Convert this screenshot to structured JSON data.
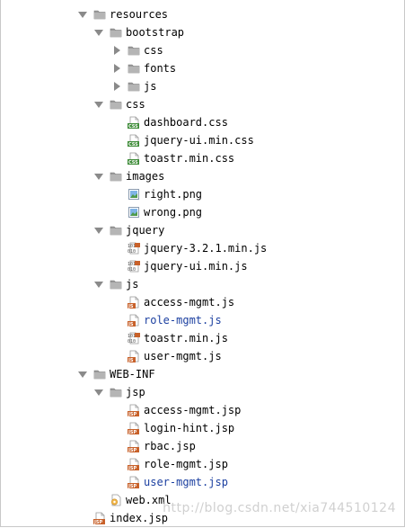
{
  "tree": [
    {
      "id": "resources",
      "label": "resources",
      "type": "folder",
      "state": "expanded",
      "depth": 0
    },
    {
      "id": "bootstrap",
      "label": "bootstrap",
      "type": "folder",
      "state": "expanded",
      "depth": 1
    },
    {
      "id": "bootstrap-css",
      "label": "css",
      "type": "folder",
      "state": "collapsed",
      "depth": 2
    },
    {
      "id": "bootstrap-fonts",
      "label": "fonts",
      "type": "folder",
      "state": "collapsed",
      "depth": 2
    },
    {
      "id": "bootstrap-js",
      "label": "js",
      "type": "folder",
      "state": "collapsed",
      "depth": 2
    },
    {
      "id": "css",
      "label": "css",
      "type": "folder",
      "state": "expanded",
      "depth": 1
    },
    {
      "id": "dashboard-css",
      "label": "dashboard.css",
      "type": "css",
      "depth": 2
    },
    {
      "id": "jquery-ui-min-css",
      "label": "jquery-ui.min.css",
      "type": "css",
      "depth": 2
    },
    {
      "id": "toastr-min-css",
      "label": "toastr.min.css",
      "type": "css",
      "depth": 2
    },
    {
      "id": "images",
      "label": "images",
      "type": "folder",
      "state": "expanded",
      "depth": 1
    },
    {
      "id": "right-png",
      "label": "right.png",
      "type": "png",
      "depth": 2
    },
    {
      "id": "wrong-png",
      "label": "wrong.png",
      "type": "png",
      "depth": 2
    },
    {
      "id": "jquery",
      "label": "jquery",
      "type": "folder",
      "state": "expanded",
      "depth": 1
    },
    {
      "id": "jquery-min-js",
      "label": "jquery-3.2.1.min.js",
      "type": "jsmin",
      "depth": 2
    },
    {
      "id": "jquery-ui-min-js",
      "label": "jquery-ui.min.js",
      "type": "jsmin",
      "depth": 2
    },
    {
      "id": "js",
      "label": "js",
      "type": "folder",
      "state": "expanded",
      "depth": 1
    },
    {
      "id": "access-mgmt-js",
      "label": "access-mgmt.js",
      "type": "js",
      "depth": 2
    },
    {
      "id": "role-mgmt-js",
      "label": "role-mgmt.js",
      "type": "js",
      "depth": 2,
      "highlight": true
    },
    {
      "id": "toastr-min-js",
      "label": "toastr.min.js",
      "type": "jsmin",
      "depth": 2
    },
    {
      "id": "user-mgmt-js",
      "label": "user-mgmt.js",
      "type": "js",
      "depth": 2
    },
    {
      "id": "web-inf",
      "label": "WEB-INF",
      "type": "folder",
      "state": "expanded",
      "depth": 0
    },
    {
      "id": "jsp",
      "label": "jsp",
      "type": "folder",
      "state": "expanded",
      "depth": 1
    },
    {
      "id": "access-mgmt-jsp",
      "label": "access-mgmt.jsp",
      "type": "jsp",
      "depth": 2
    },
    {
      "id": "login-hint-jsp",
      "label": "login-hint.jsp",
      "type": "jsp",
      "depth": 2
    },
    {
      "id": "rbac-jsp",
      "label": "rbac.jsp",
      "type": "jsp",
      "depth": 2
    },
    {
      "id": "role-mgmt-jsp",
      "label": "role-mgmt.jsp",
      "type": "jsp",
      "depth": 2
    },
    {
      "id": "user-mgmt-jsp",
      "label": "user-mgmt.jsp",
      "type": "jsp",
      "depth": 2,
      "highlight": true
    },
    {
      "id": "web-xml",
      "label": "web.xml",
      "type": "xml",
      "depth": 1
    },
    {
      "id": "index-jsp",
      "label": "index.jsp",
      "type": "jsp",
      "depth": -1
    }
  ],
  "watermark": "http://blog.csdn.net/xia744510124",
  "colors": {
    "highlight_text": "#1b3fa0",
    "folder": "#8c8c8c",
    "css_badge": "#3d8b37",
    "js_badge": "#c8612a",
    "jsp_badge": "#c8612a"
  }
}
